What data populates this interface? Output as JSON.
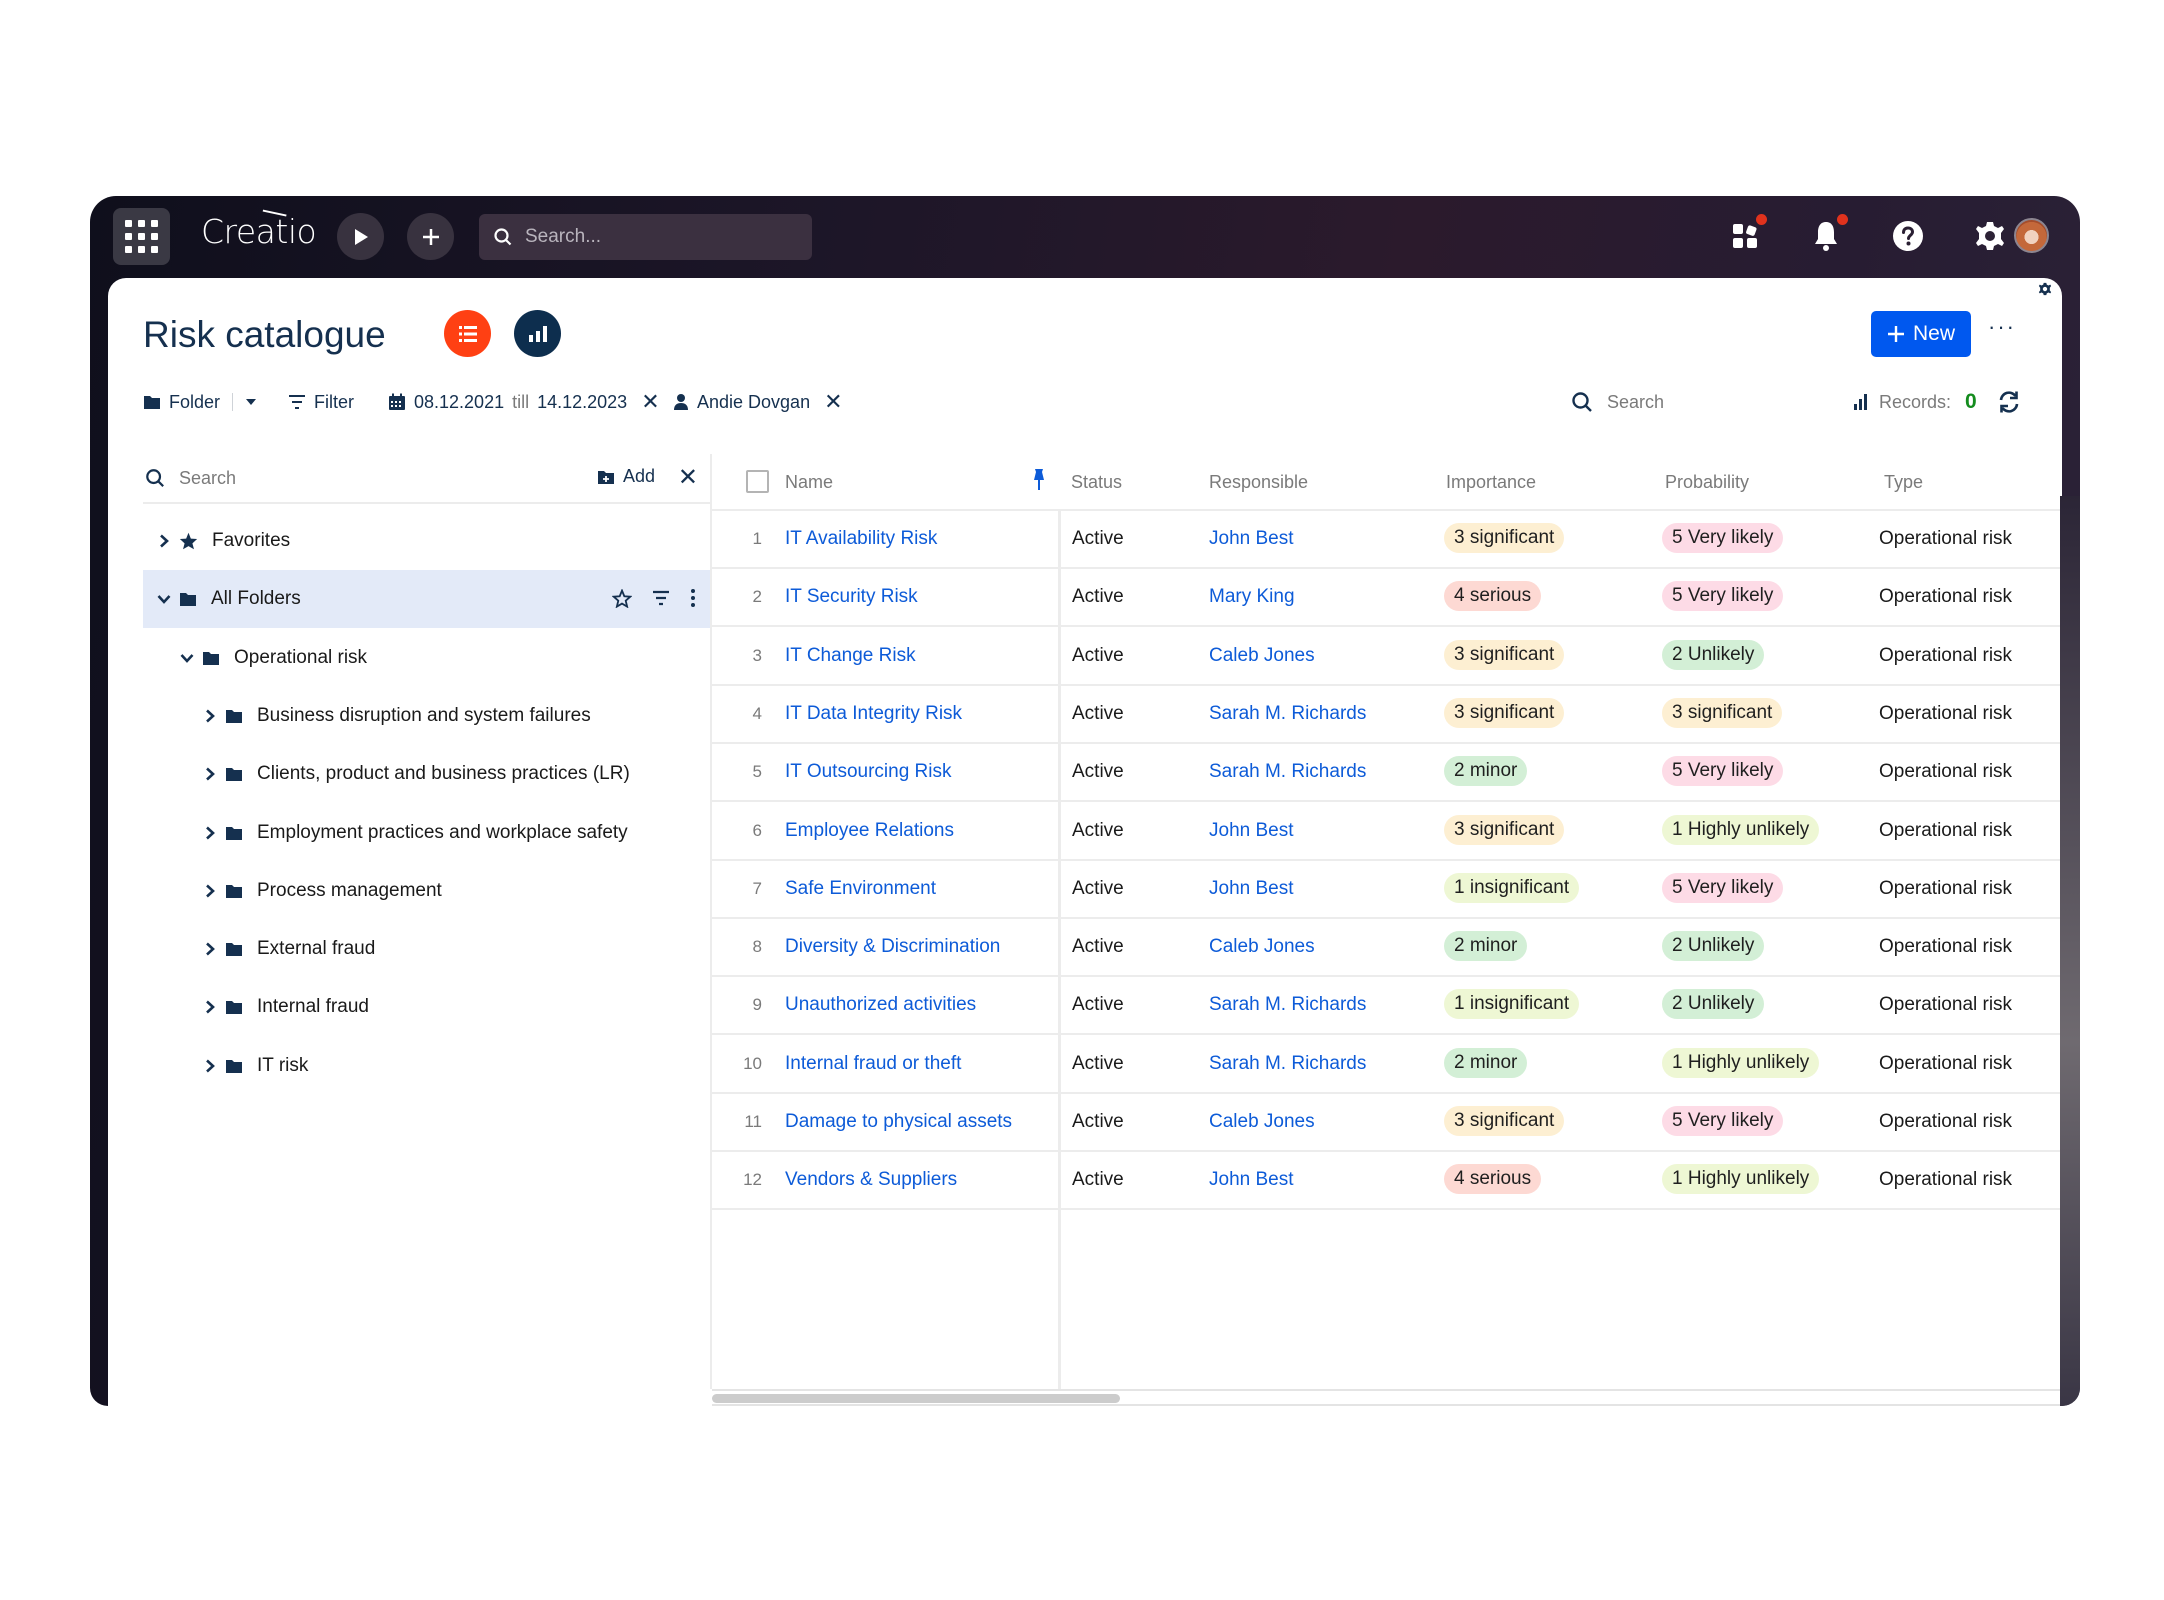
{
  "app": {
    "logo_text": "Creatio",
    "search_placeholder": "Search...",
    "icons": {
      "apps": "grid-9-dots",
      "run": "play-triangle",
      "add": "plus",
      "search": "magnifier",
      "app_hub": "squares-tiles",
      "notifications": "bell",
      "help": "question-circle",
      "settings": "gear",
      "profile": "user-avatar"
    },
    "notifications_badge": true,
    "app_hub_badge": true
  },
  "page": {
    "title": "Risk catalogue",
    "view_list_icon": "list-icon",
    "view_chart_icon": "bar-chart-icon",
    "new_label": "New",
    "more_label": "···",
    "colors": {
      "accent": "#0058ef",
      "list_view": "#ff4013",
      "chart_view": "#0d2e4e",
      "title": "#15304f",
      "link": "#0d5bd8",
      "records_count": "#148c1e"
    }
  },
  "toolbar": {
    "folder_label": "Folder",
    "filter_label": "Filter",
    "date_from": "08.12.2021",
    "date_sep": "till",
    "date_to": "14.12.2023",
    "owner_filter": "Andie Dovgan",
    "search_placeholder": "Search",
    "records_label": "Records:",
    "records_count": "0"
  },
  "folders": {
    "search_placeholder": "Search",
    "add_label": "Add",
    "items": [
      {
        "label": "Favorites",
        "level": 0,
        "expanded": false,
        "icon": "star",
        "selected": false
      },
      {
        "label": "All Folders",
        "level": 0,
        "expanded": true,
        "icon": "folder",
        "selected": true
      },
      {
        "label": "Operational risk",
        "level": 1,
        "expanded": true,
        "icon": "folder",
        "selected": false
      },
      {
        "label": "Business disruption and system failures",
        "level": 2,
        "expanded": false,
        "icon": "folder",
        "selected": false
      },
      {
        "label": "Clients, product and business practices (LR)",
        "level": 2,
        "expanded": false,
        "icon": "folder",
        "selected": false
      },
      {
        "label": "Employment practices and workplace safety",
        "level": 2,
        "expanded": false,
        "icon": "folder",
        "selected": false
      },
      {
        "label": "Process management",
        "level": 2,
        "expanded": false,
        "icon": "folder",
        "selected": false
      },
      {
        "label": "External fraud",
        "level": 2,
        "expanded": false,
        "icon": "folder",
        "selected": false
      },
      {
        "label": "Internal fraud",
        "level": 2,
        "expanded": false,
        "icon": "folder",
        "selected": false
      },
      {
        "label": "IT risk",
        "level": 2,
        "expanded": false,
        "icon": "folder",
        "selected": false
      }
    ]
  },
  "grid": {
    "columns": [
      "Name",
      "Status",
      "Responsible",
      "Importance",
      "Probability",
      "Type"
    ],
    "pill_colors": {
      "1 insignificant": "#eef7d4",
      "2 minor": "#d3efd6",
      "3 significant": "#fdefd2",
      "4 serious": "#fdd9d3",
      "1 Highly unlikely": "#eef7d4",
      "2 Unlikely": "#d3efd6",
      "3 significant_prob": "#fdefd2",
      "5 Very likely": "#fddbe6"
    },
    "rows": [
      {
        "num": "1",
        "name": "IT Availability Risk",
        "status": "Active",
        "responsible": "John Best",
        "importance": "3 significant",
        "probability": "5 Very likely",
        "type": "Operational risk"
      },
      {
        "num": "2",
        "name": "IT Security Risk",
        "status": "Active",
        "responsible": "Mary King",
        "importance": "4 serious",
        "probability": "5 Very likely",
        "type": "Operational risk"
      },
      {
        "num": "3",
        "name": "IT Change Risk",
        "status": "Active",
        "responsible": "Caleb Jones",
        "importance": "3 significant",
        "probability": "2 Unlikely",
        "type": "Operational risk"
      },
      {
        "num": "4",
        "name": "IT Data Integrity Risk",
        "status": "Active",
        "responsible": "Sarah M. Richards",
        "importance": "3 significant",
        "probability": "3 significant",
        "type": "Operational risk"
      },
      {
        "num": "5",
        "name": "IT Outsourcing Risk",
        "status": "Active",
        "responsible": "Sarah M. Richards",
        "importance": "2 minor",
        "probability": "5 Very likely",
        "type": "Operational risk"
      },
      {
        "num": "6",
        "name": "Employee Relations",
        "status": "Active",
        "responsible": "John Best",
        "importance": "3 significant",
        "probability": "1 Highly unlikely",
        "type": "Operational risk"
      },
      {
        "num": "7",
        "name": "Safe Environment",
        "status": "Active",
        "responsible": "John Best",
        "importance": "1 insignificant",
        "probability": "5 Very likely",
        "type": "Operational risk"
      },
      {
        "num": "8",
        "name": "Diversity & Discrimination",
        "status": "Active",
        "responsible": "Caleb Jones",
        "importance": "2 minor",
        "probability": "2 Unlikely",
        "type": "Operational risk"
      },
      {
        "num": "9",
        "name": "Unauthorized activities",
        "status": "Active",
        "responsible": "Sarah M. Richards",
        "importance": "1 insignificant",
        "probability": "2 Unlikely",
        "type": "Operational risk"
      },
      {
        "num": "10",
        "name": "Internal fraud or theft",
        "status": "Active",
        "responsible": "Sarah M. Richards",
        "importance": "2 minor",
        "probability": "1 Highly unlikely",
        "type": "Operational risk"
      },
      {
        "num": "11",
        "name": "Damage to physical assets",
        "status": "Active",
        "responsible": "Caleb Jones",
        "importance": "3 significant",
        "probability": "5 Very likely",
        "type": "Operational risk"
      },
      {
        "num": "12",
        "name": "Vendors & Suppliers",
        "status": "Active",
        "responsible": "John Best",
        "importance": "4 serious",
        "probability": "1 Highly unlikely",
        "type": "Operational risk"
      }
    ]
  }
}
